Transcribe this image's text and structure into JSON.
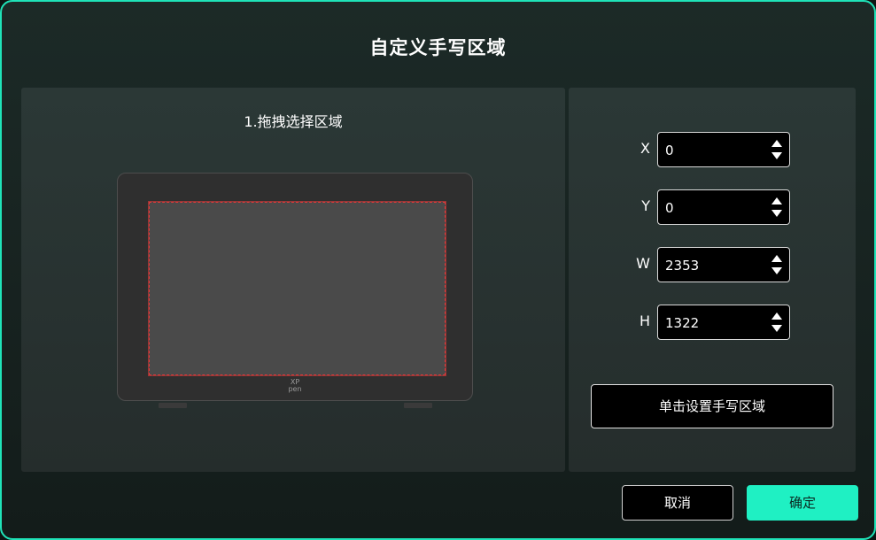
{
  "dialog": {
    "title": "自定义手写区域",
    "accent_color": "#1ff0c3"
  },
  "left_panel": {
    "step_label": "1.拖拽选择区域",
    "tablet_logo_line1": "XP",
    "tablet_logo_line2": "pen",
    "selection_color": "#e03a3a"
  },
  "fields": [
    {
      "label": "X",
      "value": "0"
    },
    {
      "label": "Y",
      "value": "0"
    },
    {
      "label": "W",
      "value": "2353"
    },
    {
      "label": "H",
      "value": "1322"
    }
  ],
  "set_area_button": "单击设置手写区域",
  "footer": {
    "cancel_label": "取消",
    "ok_label": "确定"
  }
}
